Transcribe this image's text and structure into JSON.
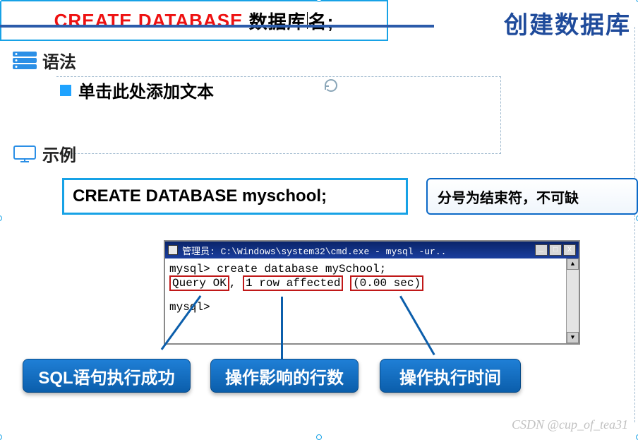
{
  "header": {
    "title": "创建数据库"
  },
  "sections": {
    "syntax_label": "语法",
    "example_label": "示例"
  },
  "bullet": {
    "add_text": "单击此处添加文本"
  },
  "syntax": {
    "keyword": "CREATE DATABASE",
    "placeholder_pre": "数据库",
    "placeholder_post": "名;"
  },
  "example": {
    "code": "CREATE DATABASE myschool;"
  },
  "note": {
    "text": "分号为结束符，不可缺"
  },
  "terminal": {
    "title_prefix": "管理员: ",
    "title_path": "C:\\Windows\\system32\\cmd.exe - mysql  -ur..",
    "line1_prompt": "mysql>",
    "line1_cmd": " create database mySchool;",
    "line2_a": "Query OK",
    "line2_comma": ",",
    "line2_b": "1 row affected",
    "line2_c": "(0.00 sec)",
    "line3_prompt": "mysql>",
    "btn_min": "_",
    "btn_max": "□",
    "btn_close": "X",
    "scroll_up": "▲",
    "scroll_down": "▼"
  },
  "callouts": {
    "c1": "SQL语句执行成功",
    "c2": "操作影响的行数",
    "c3": "操作执行时间"
  },
  "watermark": "CSDN @cup_of_tea31",
  "icons": {
    "server": "server-icon",
    "monitor": "monitor-icon",
    "reload": "reload-icon",
    "cmd": "cmd-icon"
  }
}
